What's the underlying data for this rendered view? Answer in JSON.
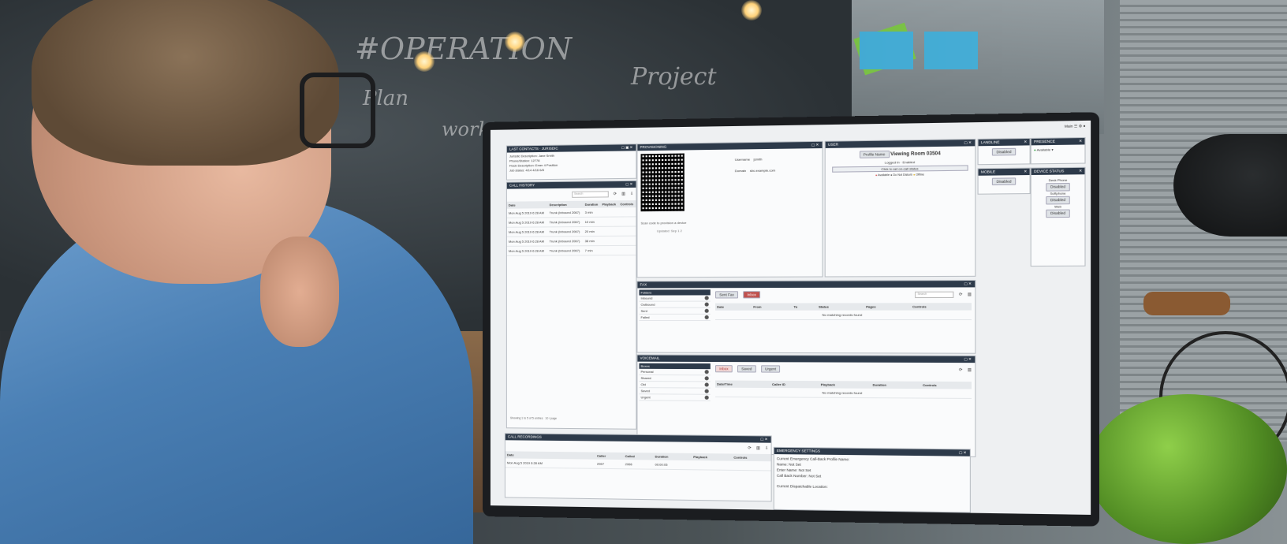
{
  "background": {
    "chalkboard_words": [
      "#OPERATION",
      "Plan",
      "Project",
      "work"
    ]
  },
  "screen": {
    "top_right": {
      "label": "Main",
      "icons": [
        "list-icon",
        "settings-icon",
        "user-icon"
      ]
    },
    "contact_panel": {
      "title": "LAST CONTACTS · JURISDIC",
      "lines": [
        "Jurisdic Description: Jane Smith",
        "Phone/Station: 12778",
        "Flock Description: Emer 4 Position",
        "Job status: 4/14 4/16 6/8"
      ]
    },
    "qr_panel": {
      "title": "PROVISIONING",
      "fields": [
        {
          "label": "Username",
          "value": "jsmith"
        },
        {
          "label": "Domain",
          "value": "sbc.example.com"
        }
      ],
      "note": "Scan code to provision a device",
      "sub_note": "Updated: Sep 1 2"
    },
    "user_panel": {
      "title": "USER",
      "user_label": "Profile Name",
      "user_name": "Viewing Room 03504",
      "line1": "Logged In",
      "line1_value": "Enabled",
      "bar": "Click to set on-call status",
      "legend": [
        "Available",
        "Do Not Disturb",
        "Offline"
      ]
    },
    "small_panel_a": {
      "title": "LANDLINE",
      "button": "Disabled"
    },
    "small_panel_b": {
      "title": "PRESENCE",
      "status": "Available"
    },
    "small_panel_c": {
      "title": "MOBILE",
      "button": "Disabled"
    },
    "small_panel_d": {
      "title": "DEVICE STATUS",
      "items": [
        {
          "label": "Desk Phone",
          "button": "Disabled"
        },
        {
          "label": "Softphone",
          "button": "Disabled"
        },
        {
          "label": "Web",
          "button": "Disabled"
        }
      ]
    },
    "call_history": {
      "title": "CALL HISTORY",
      "search_placeholder": "Search",
      "columns": [
        "Date",
        "Description",
        "Duration",
        "Playback",
        "Controls"
      ],
      "rows": [
        {
          "date": "Mon Aug 5 2019 6:28 AM",
          "desc": "Trunk (Inbound 2067)",
          "dur": "3 min"
        },
        {
          "date": "Mon Aug 5 2019 6:28 AM",
          "desc": "Trunk (Inbound 2067)",
          "dur": "10 min"
        },
        {
          "date": "Mon Aug 5 2019 6:28 AM",
          "desc": "Trunk (Inbound 2067)",
          "dur": "20 min"
        },
        {
          "date": "Mon Aug 5 2019 6:28 AM",
          "desc": "Trunk (Inbound 2067)",
          "dur": "38 min"
        },
        {
          "date": "Mon Aug 5 2019 6:28 AM",
          "desc": "Trunk (Inbound 2067)",
          "dur": "7 min"
        }
      ],
      "footer": "Showing 1 to 5 of 5 entries",
      "footer_right": "10 / page"
    },
    "faxes": {
      "title": "FAX",
      "sidebar_title": "Folders",
      "sidebar_items": [
        "Inbound",
        "Outbound",
        "Sent",
        "Failed"
      ],
      "tabs": [
        "Sent Fax",
        "Inbox"
      ],
      "search_placeholder": "Search",
      "columns": [
        "Date",
        "From",
        "To",
        "Status",
        "Pages",
        "Controls"
      ],
      "empty": "No matching records found"
    },
    "voicemail": {
      "title": "VOICEMAIL",
      "sidebar_title": "Boxes",
      "sidebar_items": [
        "Personal",
        "Shared",
        "Old",
        "Saved",
        "Urgent"
      ],
      "tabs": [
        "Inbox",
        "Saved",
        "Urgent"
      ],
      "columns": [
        "Date/Time",
        "Caller ID",
        "Playback",
        "Duration",
        "Controls"
      ],
      "empty": "No matching records found"
    },
    "recordings": {
      "title": "CALL RECORDINGS",
      "columns": [
        "Date",
        "Caller",
        "Called",
        "Duration",
        "Playback",
        "Controls"
      ],
      "row": {
        "date": "Mon Aug 5 2019 6:28 AM",
        "caller": "2067",
        "called": "2066",
        "duration": "00:00:05"
      }
    },
    "emergency": {
      "title": "EMERGENCY SETTINGS",
      "line1": "Current Emergency Call-Back Profile Name:",
      "line2": "Name: Not Set",
      "line3": "Enter Name: Not Set",
      "line4": "Call Back Number: Not Set",
      "line5": "Current Dispatchable Location:"
    }
  }
}
